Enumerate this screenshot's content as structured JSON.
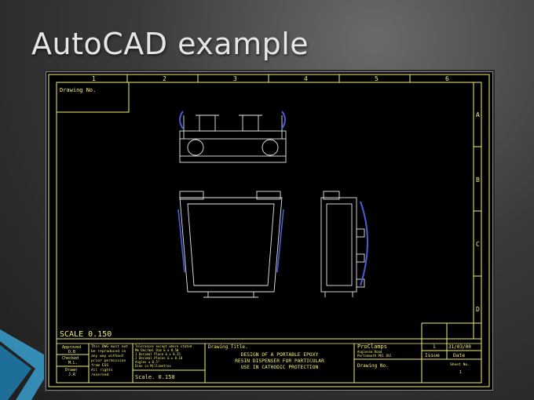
{
  "slide": {
    "title": "AutoCAD example"
  },
  "drawing": {
    "column_labels": [
      "1",
      "2",
      "3",
      "4",
      "5",
      "6"
    ],
    "row_labels": [
      "A",
      "B",
      "C",
      "D"
    ],
    "drawing_no_label": "Drawing No.",
    "scale_large": "SCALE  0.150",
    "approved_label": "Approved",
    "approved_by": "D.B",
    "checked_label": "Checked",
    "checked_by": "M.L.",
    "drawn_label": "Drawn",
    "drawn_by": "J.R",
    "copyright_lines": [
      "This DWG must not",
      "be reproduced in",
      "any way without",
      "prior permission",
      "from ESS",
      "All rights",
      "reserved"
    ],
    "tolerance_lines": [
      "Tolerances except where stated",
      "Mm Dec/mal Dim & ± 0.50",
      "1 Decimal Place & ± 0.25",
      "2 Decimal Places & ± 0.10",
      "Angles ± 0.5°",
      "Dims in Millimetres"
    ],
    "scale_small": "Scale. 0.150",
    "drawing_title_label": "Drawing Title.",
    "title_lines": [
      "DESIGN OF A PORTABLE EPOXY",
      "RESIN DISPENSER FOR PARTICULAR",
      "USE IN CATHODIC PROTECTION"
    ],
    "company_name": "ProClamps",
    "company_address": [
      "Anglesea Road",
      "Portsmouth PO1 3DJ"
    ],
    "issue_value": "1",
    "date_value": "31/03/00",
    "issue_label": "Issue",
    "date_label": "Date",
    "drawing_no_label_2": "Drawing No.",
    "sheet_label": "Sheet No.",
    "sheet_value": "1"
  }
}
